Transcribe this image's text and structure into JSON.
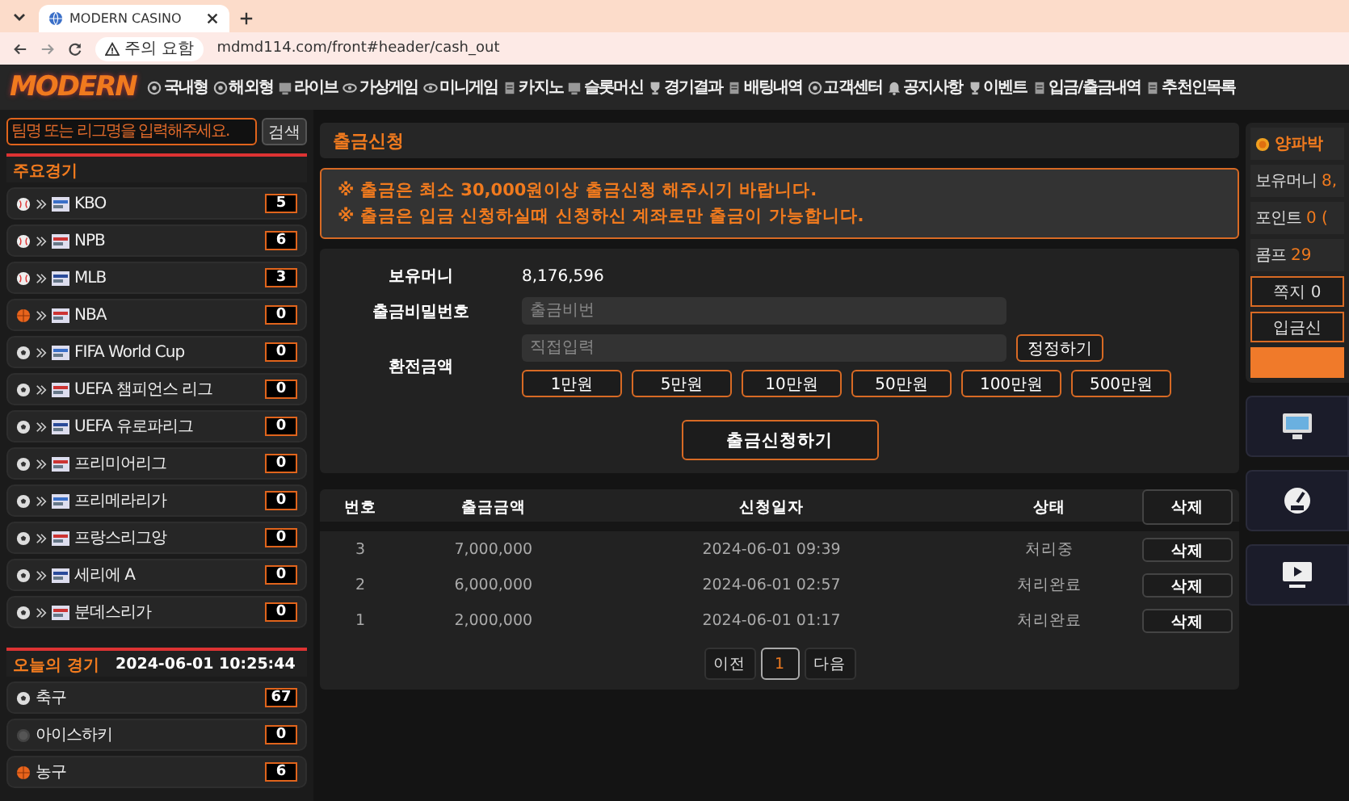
{
  "browser": {
    "tab_title": "MODERN CASINO",
    "security_label": "주의 요함",
    "url": "mdmd114.com/front#header/cash_out"
  },
  "header": {
    "logo": "MODERN",
    "nav": [
      {
        "label": "국내형"
      },
      {
        "label": "해외형"
      },
      {
        "label": "라이브"
      },
      {
        "label": "가상게임"
      },
      {
        "label": "미니게임"
      },
      {
        "label": "카지노"
      },
      {
        "label": "슬롯머신"
      },
      {
        "label": "경기결과"
      },
      {
        "label": "배팅내역"
      },
      {
        "label": "고객센터"
      },
      {
        "label": "공지사항"
      },
      {
        "label": "이벤트"
      },
      {
        "label": "입금/출금내역"
      },
      {
        "label": "추천인목록"
      }
    ]
  },
  "sidebar": {
    "search": {
      "placeholder": "팀명 또는 리그명을 입력해주세요.",
      "button": "검색"
    },
    "major_title": "주요경기",
    "major": [
      {
        "name": "KBO",
        "kind": "baseball",
        "count": "5"
      },
      {
        "name": "NPB",
        "kind": "baseball",
        "count": "6"
      },
      {
        "name": "MLB",
        "kind": "baseball",
        "count": "3"
      },
      {
        "name": "NBA",
        "kind": "basketball",
        "count": "0"
      },
      {
        "name": "FIFA World Cup",
        "kind": "soccer",
        "count": "0"
      },
      {
        "name": "UEFA 챔피언스 리그",
        "kind": "soccer",
        "count": "0"
      },
      {
        "name": "UEFA 유로파리그",
        "kind": "soccer",
        "count": "0"
      },
      {
        "name": "프리미어리그",
        "kind": "soccer",
        "count": "0"
      },
      {
        "name": "프리메라리가",
        "kind": "soccer",
        "count": "0"
      },
      {
        "name": "프랑스리그앙",
        "kind": "soccer",
        "count": "0"
      },
      {
        "name": "세리에 A",
        "kind": "soccer",
        "count": "0"
      },
      {
        "name": "분데스리가",
        "kind": "soccer",
        "count": "0"
      }
    ],
    "today_title": "오늘의 경기",
    "today_clock": "2024-06-01 10:25:44",
    "today": [
      {
        "name": "축구",
        "kind": "soccer",
        "count": "67"
      },
      {
        "name": "아이스하키",
        "kind": "hockey",
        "count": "0"
      },
      {
        "name": "농구",
        "kind": "basketball",
        "count": "6"
      }
    ]
  },
  "main": {
    "title": "출금신청",
    "notices": [
      "※ 출금은 최소 30,000원이상 출금신청 해주시기 바랍니다.",
      "※ 출금은 입금 신청하실때 신청하신 계좌로만 출금이 가능합니다."
    ],
    "form": {
      "balance_label": "보유머니",
      "balance": "8,176,596",
      "password_label": "출금비밀번호",
      "password_placeholder": "출금비번",
      "amount_label": "환전금액",
      "amount_placeholder": "직접입력",
      "reset_button": "정정하기",
      "amounts": [
        "1만원",
        "5만원",
        "10만원",
        "50만원",
        "100만원",
        "500만원"
      ],
      "submit": "출금신청하기"
    },
    "history": {
      "columns": [
        "번호",
        "출금금액",
        "신청일자",
        "상태"
      ],
      "delete_all": "삭제",
      "rows": [
        {
          "no": "3",
          "amount": "7,000,000",
          "date": "2024-06-01 09:39",
          "status": "처리중",
          "action": "삭제"
        },
        {
          "no": "2",
          "amount": "6,000,000",
          "date": "2024-06-01 02:57",
          "status": "처리완료",
          "action": "삭제"
        },
        {
          "no": "1",
          "amount": "2,000,000",
          "date": "2024-06-01 01:17",
          "status": "처리완료",
          "action": "삭제"
        }
      ],
      "pagination": {
        "prev": "이전",
        "pages": [
          {
            "label": "1",
            "selected": true
          }
        ],
        "next": "다음"
      }
    }
  },
  "account": {
    "username": "양파박",
    "rows": [
      {
        "label": "보유머니",
        "value": "8,"
      },
      {
        "label": "포인트",
        "value": "0 ("
      },
      {
        "label": "콤프",
        "value": "29"
      }
    ],
    "message_button": "쪽지 0",
    "deposit_button": "입금신"
  }
}
